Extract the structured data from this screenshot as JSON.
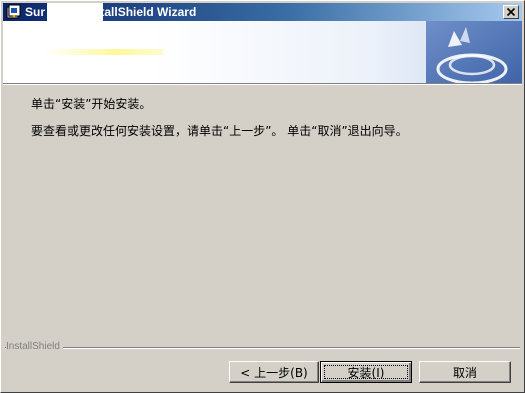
{
  "window": {
    "title": "Sur          er 7.2 InstallShield Wizard",
    "colors": {
      "titlebar_start": "#0a246a",
      "titlebar_end": "#a6caf0",
      "face": "#d4d0c8"
    },
    "close_icon": "close-icon",
    "app_icon": "installer-icon"
  },
  "banner": {
    "logo_icon": "installshield-logo-icon"
  },
  "content": {
    "line1": "单击“安装”开始安装。",
    "line2": "要查看或更改任何安装设置，请单击“上一步”。 单击“取消”退出向导。"
  },
  "footer": {
    "brand": "InstallShield",
    "buttons": {
      "back": "< 上一步(B)",
      "install": "安装(I)",
      "cancel": "取消"
    }
  }
}
